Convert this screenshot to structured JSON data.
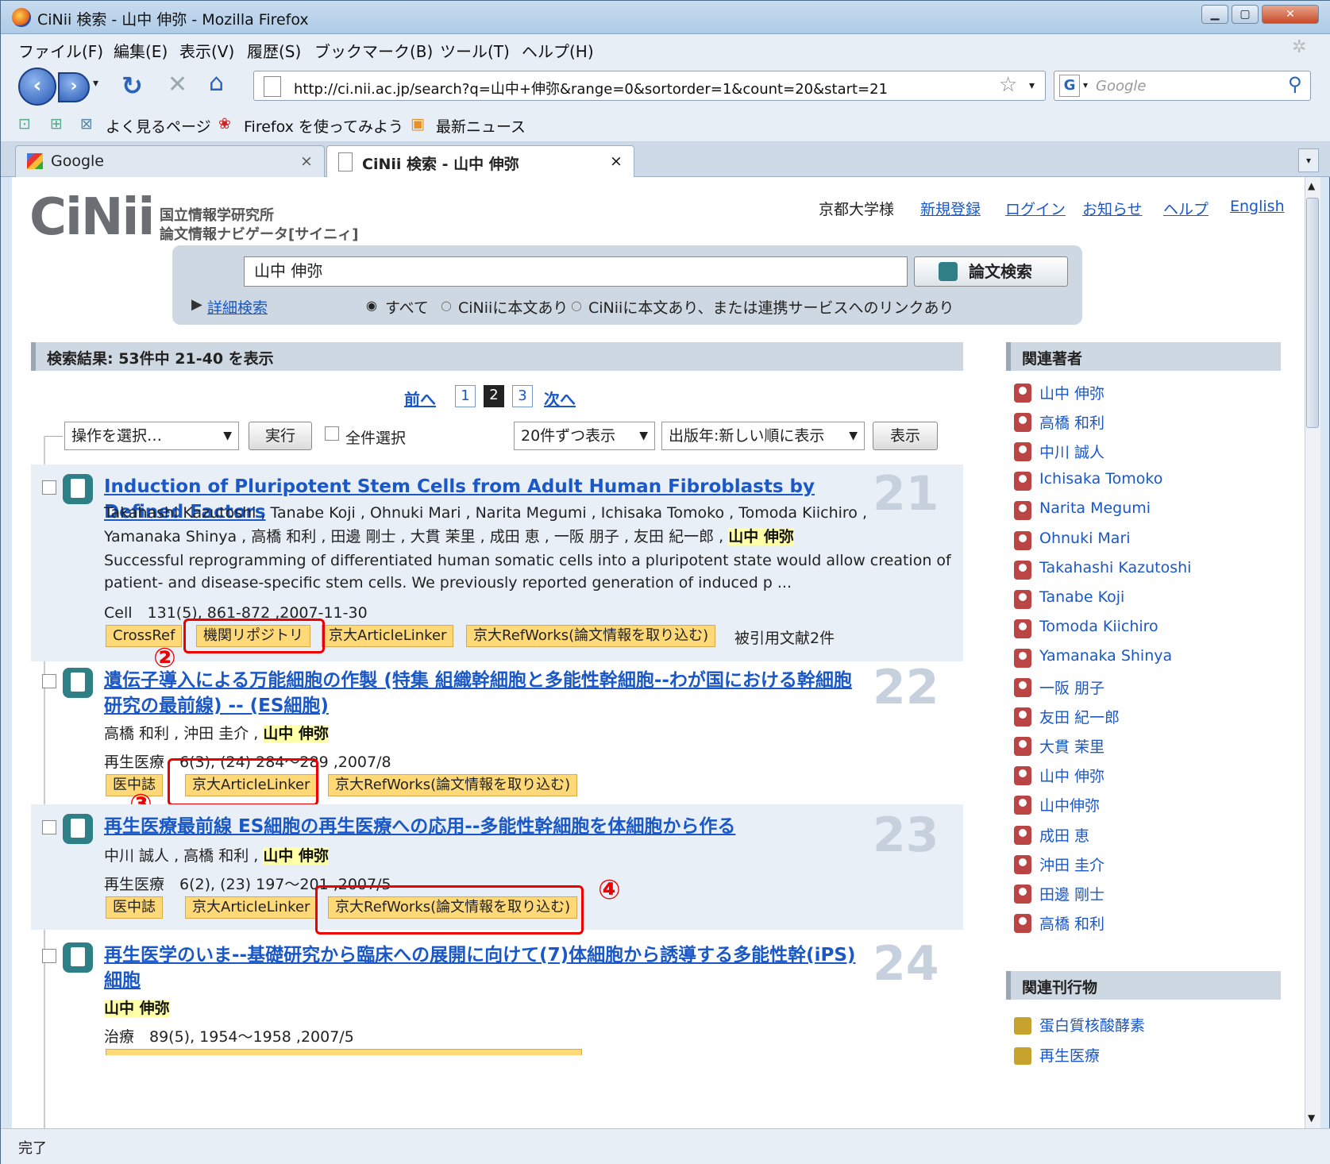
{
  "window": {
    "title": "CiNii 検索 -  山中 伸弥 - Mozilla Firefox"
  },
  "menu": [
    "ファイル(F)",
    "編集(E)",
    "表示(V)",
    "履歴(S)",
    "ブックマーク(B)",
    "ツール(T)",
    "ヘルプ(H)"
  ],
  "nav": {
    "url": "http://ci.nii.ac.jp/search?q=山中+伸弥&range=0&sortorder=1&count=20&start=21",
    "search_placeholder": "Google"
  },
  "bookmarks": [
    "よく見るページ",
    "Firefox を使ってみよう",
    "最新ニュース"
  ],
  "tabs": [
    {
      "label": "Google"
    },
    {
      "label": "CiNii 検索 -  山中 伸弥"
    }
  ],
  "site": {
    "logo": "CiNii",
    "org_line1": "国立情報学研究所",
    "org_line2": "論文情報ナビゲータ[サイニィ]",
    "user": "京都大学様",
    "links": [
      "新規登録",
      "ログイン",
      "お知らせ",
      "ヘルプ",
      "English"
    ]
  },
  "search": {
    "query": "山中 伸弥",
    "button": "論文検索",
    "advanced": "詳細検索",
    "options": [
      "すべて",
      "CiNiiに本文あり",
      "CiNiiに本文あり、または連携サービスへのリンクあり"
    ]
  },
  "results": {
    "summary": "検索結果:  53件中 21-40 を表示",
    "prev": "前へ",
    "next": "次へ",
    "pages": [
      "1",
      "2",
      "3"
    ],
    "action_select": "操作を選択…",
    "run": "実行",
    "select_all": "全件選択",
    "per_page": "20件ずつ表示",
    "sort": "出版年:新しい順に表示",
    "show": "表示"
  },
  "papers": [
    {
      "num": "21",
      "title": "Induction of Pluripotent Stem Cells from Adult Human Fibroblasts by Defined Factors",
      "authors1": "Takahashi Kazutoshi , Tanabe Koji , Ohnuki Mari , Narita Megumi , Ichisaka Tomoko , Tomoda Kiichiro ,",
      "authors2": "Yamanaka Shinya , 高橋 和利 , 田邊 剛士 , 大貫 茉里 , 成田 恵 , 一阪 朋子 , 友田 紀一郎 ,",
      "hl": "山中 伸弥",
      "abs1": "Successful reprogramming of differentiated human somatic cells into a pluripotent state would allow creation of",
      "abs2": "patient- and disease-specific stem cells. We previously reported generation of induced p ...",
      "source": "Cell　131(5), 861-872 ,2007-11-30",
      "badges": [
        "CrossRef",
        "機関リポジトリ",
        "京大ArticleLinker",
        "京大RefWorks(論文情報を取り込む)"
      ],
      "cited": "被引用文献2件"
    },
    {
      "num": "22",
      "title1": "遺伝子導入による万能細胞の作製 (特集 組織幹細胞と多能性幹細胞--わが国における幹細胞",
      "title2": "研究の最前線) -- (ES細胞)",
      "authors": "高橋 和利 , 沖田 圭介 ,",
      "hl": "山中 伸弥",
      "source": "再生医療　6(3), (24)  284～289 ,2007/8",
      "badges": [
        "医中誌",
        "京大ArticleLinker",
        "京大RefWorks(論文情報を取り込む)"
      ]
    },
    {
      "num": "23",
      "title": "再生医療最前線 ES細胞の再生医療への応用--多能性幹細胞を体細胞から作る",
      "authors": "中川 誠人 , 高橋 和利 ,",
      "hl": "山中 伸弥",
      "source": "再生医療　6(2), (23)  197～201 ,2007/5",
      "badges": [
        "医中誌",
        "京大ArticleLinker",
        "京大RefWorks(論文情報を取り込む)"
      ]
    },
    {
      "num": "24",
      "title1": "再生医学のいま--基礎研究から臨床への展開に向けて(7)体細胞から誘導する多能性幹(iPS)",
      "title2": "細胞",
      "hl": "山中 伸弥",
      "source": "治療　89(5), 1954～1958 ,2007/5"
    }
  ],
  "annotations": [
    "②",
    "③",
    "④"
  ],
  "sidebar": {
    "authors_title": "関連著者",
    "authors": [
      "山中 伸弥",
      "高橋 和利",
      "中川 誠人",
      "Ichisaka Tomoko",
      "Narita Megumi",
      "Ohnuki Mari",
      "Takahashi Kazutoshi",
      "Tanabe Koji",
      "Tomoda Kiichiro",
      "Yamanaka Shinya",
      "一阪 朋子",
      "友田 紀一郎",
      "大貫 茉里",
      "山中 伸弥",
      "山中伸弥",
      "成田 恵",
      "沖田 圭介",
      "田邊 剛士",
      "高橋 和利"
    ],
    "journals_title": "関連刊行物",
    "journals": [
      "蛋白質核酸酵素",
      "再生医療"
    ]
  },
  "status": "完了"
}
